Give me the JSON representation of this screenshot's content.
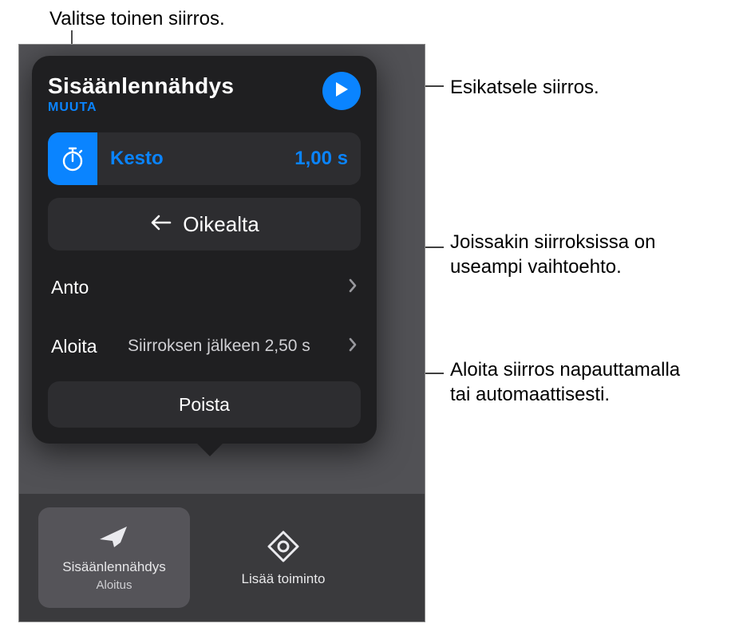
{
  "callouts": {
    "topLeft": "Valitse toinen siirros.",
    "right1": "Esikatsele siirros.",
    "right2": "Joissakin siirroksissa on\nuseampi vaihtoehto.",
    "right3": "Aloita siirros napauttamalla\ntai automaattisesti."
  },
  "popover": {
    "title": "Sisäänlennähdys",
    "change": "MUUTA",
    "duration": {
      "label": "Kesto",
      "value": "1,00  s"
    },
    "direction": "Oikealta",
    "rows": {
      "accel": {
        "label": "Anto"
      },
      "start": {
        "label": "Aloita",
        "value": "Siirroksen\njälkeen  2,50  s"
      }
    },
    "remove": "Poista"
  },
  "tiles": {
    "buildIn": {
      "title": "Sisäänlennähdys",
      "sub": "Aloitus"
    },
    "addAction": {
      "title": "Lisää toiminto"
    }
  }
}
